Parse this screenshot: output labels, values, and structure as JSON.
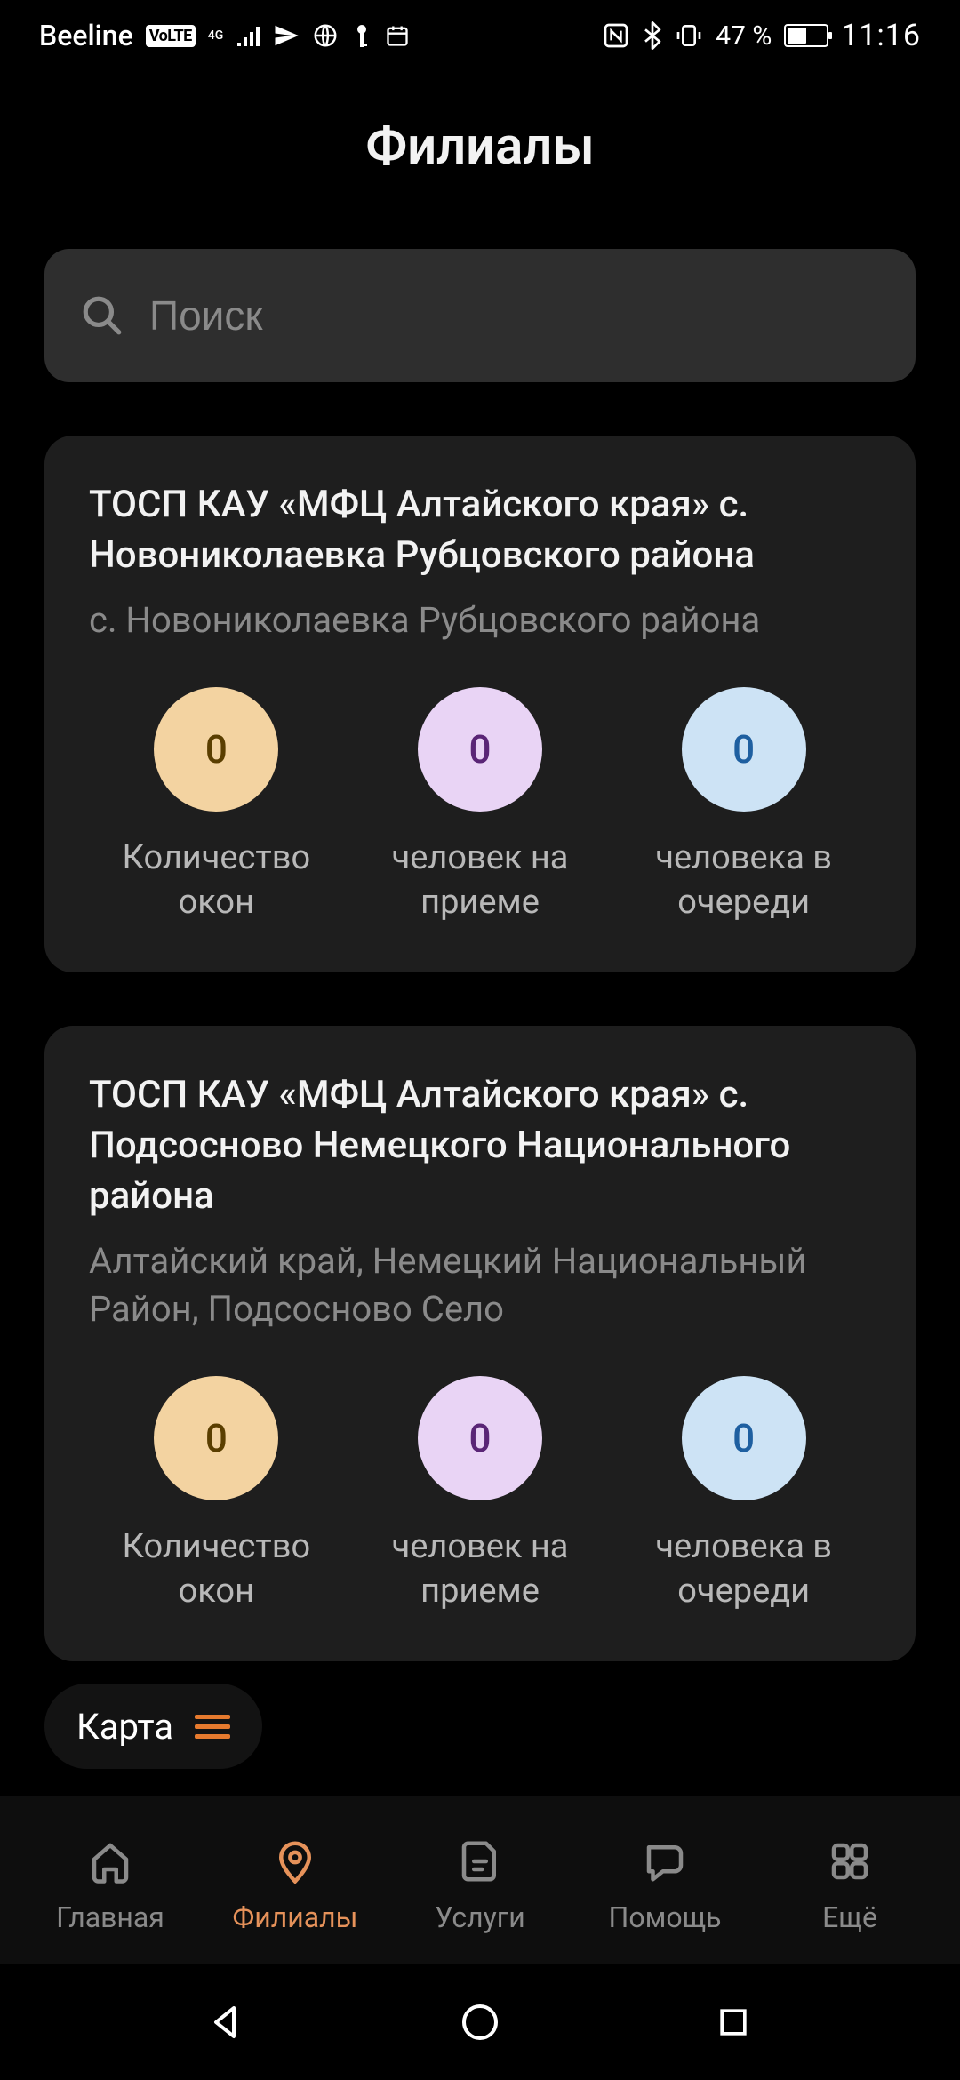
{
  "status": {
    "carrier": "Beeline",
    "volte": "VoLTE",
    "net": "4G",
    "battery_pct": "47 %",
    "time": "11:16"
  },
  "header": {
    "title": "Филиалы"
  },
  "search": {
    "placeholder": "Поиск"
  },
  "stat_labels": {
    "windows": "Количество\nокон",
    "serving": "человек на\nприеме",
    "queue": "человека в\nочереди"
  },
  "branches": [
    {
      "title": "ТОСП КАУ «МФЦ Алтайского края»  с. Новониколаевка  Рубцовского  района",
      "subtitle": "с. Новониколаевка  Рубцовского  района",
      "windows": "0",
      "serving": "0",
      "queue": "0"
    },
    {
      "title": "ТОСП КАУ «МФЦ Алтайского края» с. Подсосново  Немецкого Национального района",
      "subtitle": "Алтайский край, Немецкий Национальный Район, Подсосново Село",
      "windows": "0",
      "serving": "0",
      "queue": "0"
    }
  ],
  "fab": {
    "label": "Карта"
  },
  "nav": {
    "home": "Главная",
    "branches": "Филиалы",
    "services": "Услуги",
    "help": "Помощь",
    "more": "Ещё"
  }
}
